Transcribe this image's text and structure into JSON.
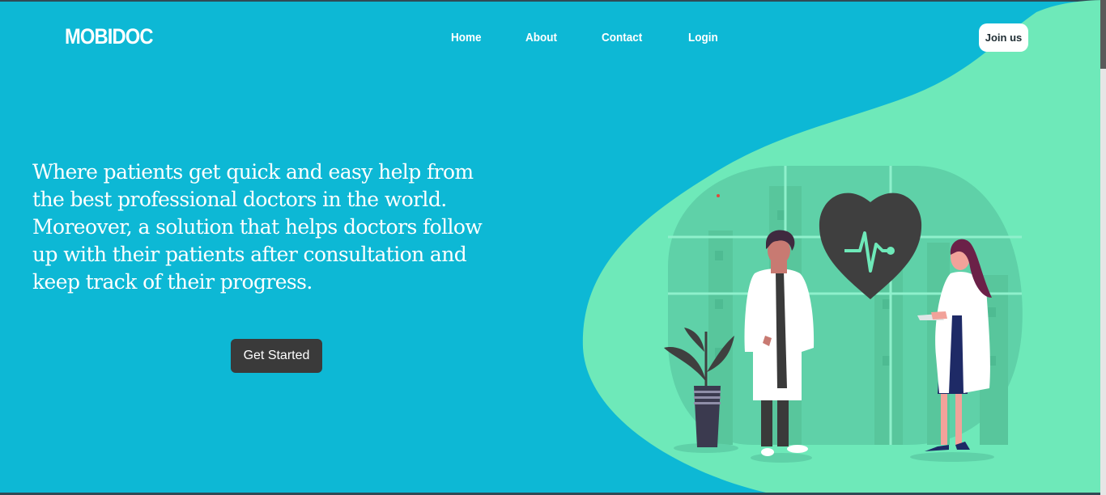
{
  "brand": {
    "name": "MOBIDOC"
  },
  "nav": {
    "links": [
      {
        "label": "Home"
      },
      {
        "label": "About"
      },
      {
        "label": "Contact"
      },
      {
        "label": "Login"
      }
    ],
    "join_label": "Join us"
  },
  "hero": {
    "lines": [
      "Where patients get quick and easy help from",
      "the best professional doctors in the world.",
      "Moreover, a solution that helps doctors follow",
      "up with their patients after consultation and",
      "keep track of their progress."
    ],
    "cta_label": "Get Started"
  },
  "colors": {
    "background": "#0db8d5",
    "blob": "#6ee9b9",
    "button_dark": "#3a3a3a",
    "heart": "#3f3f3f"
  },
  "icons": [
    "heart-pulse-icon"
  ]
}
